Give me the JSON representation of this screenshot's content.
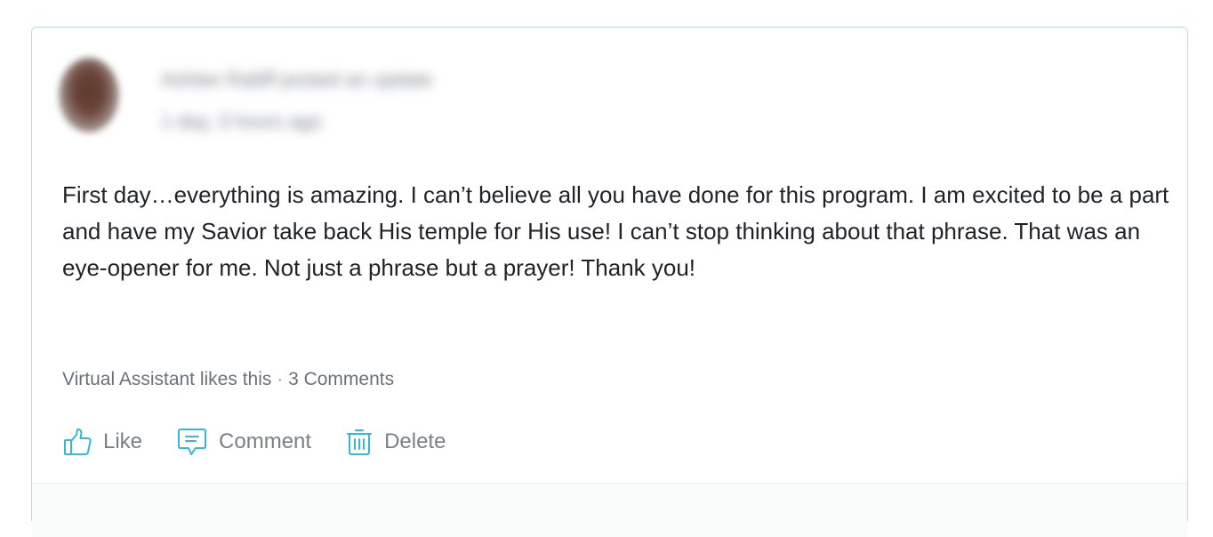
{
  "post": {
    "author_line": "Ashlee Ratliff posted an update",
    "time_line": "1 day, 3 hours ago",
    "body": "First day…everything is amazing. I can’t believe all you have done for this program. I am excited to be a part and have my Savior take back His temple for His use! I can’t stop thinking about that phrase. That was an eye-opener for me. Not just a phrase but a prayer! Thank you!",
    "likes_text": "Virtual Assistant likes this",
    "separator": "·",
    "comments_text": "3 Comments"
  },
  "actions": {
    "like_label": "Like",
    "comment_label": "Comment",
    "delete_label": "Delete",
    "icons": {
      "like": "thumbs-up-icon",
      "comment": "comment-bubble-icon",
      "delete": "trash-icon"
    },
    "icon_color": "#35b8d6"
  },
  "colors": {
    "card_border": "#b9dde3",
    "text": "#1f2329",
    "muted": "#6b717a"
  }
}
